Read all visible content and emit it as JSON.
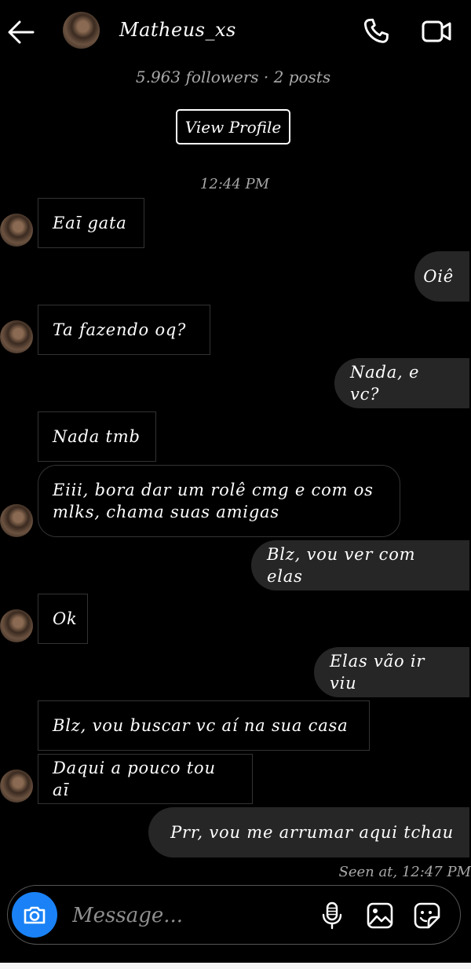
{
  "header": {
    "username": "Matheus_xs",
    "back_icon": "arrow-left-icon",
    "call_icon": "phone-icon",
    "video_icon": "video-camera-icon"
  },
  "profile": {
    "meta": "5.963 followers · 2 posts",
    "view_profile_label": "View Profile"
  },
  "conversation": {
    "timestamp": "12:44 PM",
    "messages": [
      {
        "from": "them",
        "text": "Eaī gata"
      },
      {
        "from": "me",
        "text": "Oiê"
      },
      {
        "from": "them",
        "text": "Ta fazendo oq?"
      },
      {
        "from": "me",
        "text": "Nada, e vc?"
      },
      {
        "from": "them",
        "text": "Nada tmb"
      },
      {
        "from": "them",
        "text": "Eiii, bora dar um rolê cmg e com os mlks, chama suas amigas"
      },
      {
        "from": "me",
        "text": "Blz, vou ver com elas"
      },
      {
        "from": "them",
        "text": "Ok"
      },
      {
        "from": "me",
        "text": "Elas vão ir viu"
      },
      {
        "from": "them",
        "text": "Blz, vou buscar vc aí na sua casa"
      },
      {
        "from": "them",
        "text": "Daqui a pouco tou aī"
      },
      {
        "from": "me",
        "text": "Prr, vou me arrumar aqui tchau"
      }
    ],
    "seen_status": "Seen at, 12:47 PM"
  },
  "composer": {
    "placeholder": "Message...",
    "camera_icon": "camera-icon",
    "mic_icon": "microphone-icon",
    "gallery_icon": "gallery-icon",
    "sticker_icon": "sticker-icon"
  },
  "colors": {
    "background": "#000000",
    "outgoing_bubble": "#262626",
    "incoming_border": "#333333",
    "accent": "#1a82f6",
    "muted_text": "#a9a9a9"
  }
}
